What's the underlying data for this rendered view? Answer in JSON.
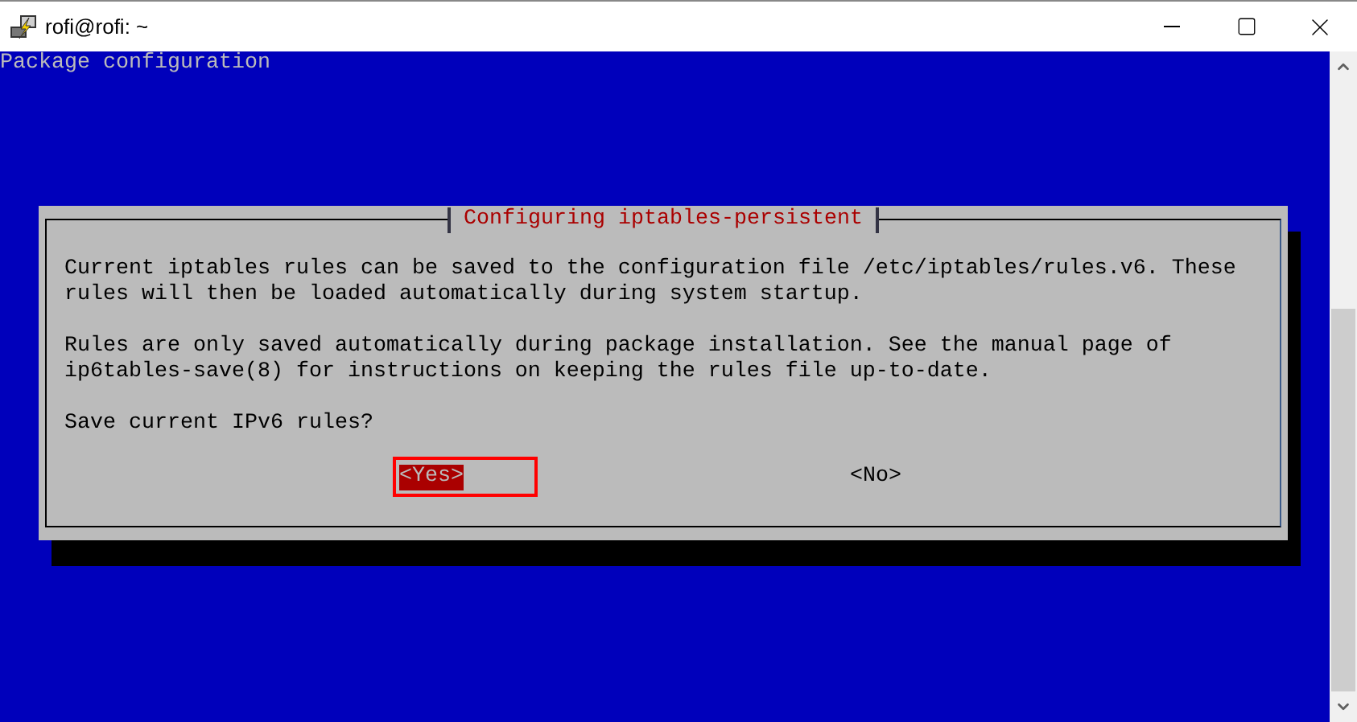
{
  "window": {
    "title": "rofi@rofi: ~"
  },
  "terminal": {
    "header": "Package configuration",
    "dialog": {
      "title": "Configuring iptables-persistent",
      "paragraphs": [
        [
          "Current iptables rules can be saved to the configuration file /etc/iptables/rules.v6. These",
          "rules will then be loaded automatically during system startup."
        ],
        [
          "Rules are only saved automatically during package installation. See the manual page of",
          "ip6tables-save(8) for instructions on keeping the rules file up-to-date."
        ]
      ],
      "question": "Save current IPv6 rules?",
      "buttons": [
        {
          "label": "<Yes>",
          "selected": true
        },
        {
          "label": "<No>",
          "selected": false
        }
      ]
    }
  }
}
